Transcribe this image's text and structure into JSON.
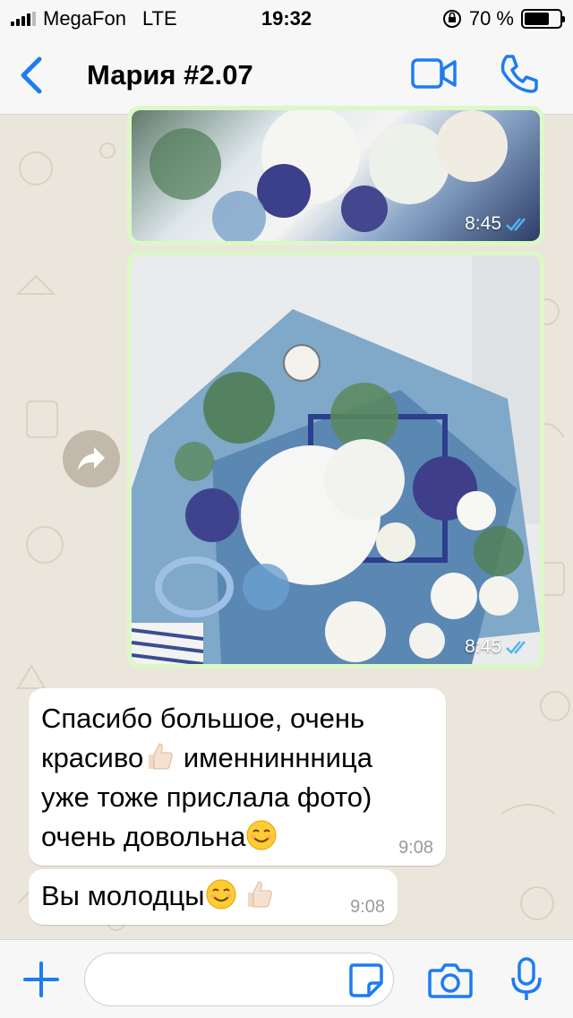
{
  "status_bar": {
    "carrier": "MegaFon",
    "network": "LTE",
    "time": "19:32",
    "battery_percent": "70 %",
    "battery_level": 0.7
  },
  "header": {
    "title": "Мария #2.07",
    "icons": [
      "chevron-left-icon",
      "video-camera-icon",
      "phone-icon"
    ],
    "accent_color": "#1d7cf2"
  },
  "messages": [
    {
      "type": "image",
      "direction": "outgoing",
      "time": "8:45",
      "status": "read"
    },
    {
      "type": "image",
      "direction": "outgoing",
      "time": "8:45",
      "status": "read"
    },
    {
      "type": "text",
      "direction": "incoming",
      "time": "9:08",
      "lines": [
        "Спасибо большое, очень",
        "красиво",
        " именниннница",
        "уже тоже прислала фото)",
        "очень довольна"
      ],
      "emojis": [
        "thumbs-up",
        "smiling-face"
      ]
    },
    {
      "type": "text",
      "direction": "incoming",
      "time": "9:08",
      "text": "Вы молодцы",
      "emojis": [
        "smiling-face",
        "thumbs-up"
      ]
    }
  ],
  "input": {
    "placeholder": ""
  },
  "colors": {
    "outgoing_bubble": "#dcf8c6",
    "incoming_bubble": "#ffffff",
    "wallpaper": "#ebe6dc",
    "read_ticks": "#4fb6ec"
  }
}
